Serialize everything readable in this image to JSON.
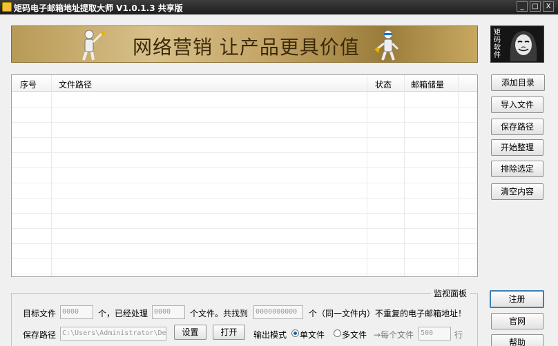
{
  "window": {
    "title": "矩码电子邮箱地址提取大师 V1.0.1.3 共享版",
    "min_label": "_",
    "max_label": "□",
    "close_label": "X"
  },
  "banner": {
    "slogan": "网络营销  让产品更具价值",
    "logo_text": "矩码软件"
  },
  "table": {
    "columns": [
      "序号",
      "文件路径",
      "状态",
      "邮箱储量"
    ],
    "rows": []
  },
  "side_buttons": [
    "添加目录",
    "导入文件",
    "保存路径",
    "开始整理",
    "排除选定",
    "清空内容"
  ],
  "bottom_buttons": [
    "注册",
    "官网",
    "帮助"
  ],
  "monitor": {
    "title": "监视面板",
    "target_label": "目标文件",
    "target_value": "0000",
    "processed_label": "个，已经处理",
    "processed_value": "0000",
    "found_label": "个文件。共找到",
    "found_value": "0000000000",
    "unique_label": "个（同一文件内）不重复的电子邮箱地址！",
    "save_path_label": "保存路径",
    "save_path_value": "C:\\Users\\Administrator\\Des",
    "set_button": "设置",
    "open_button": "打开",
    "mode_label": "输出模式",
    "mode_options": [
      "单文件",
      "多文件"
    ],
    "mode_selected": "单文件",
    "per_file_label": "→每个文件",
    "per_file_value": "500",
    "lines_label": "行"
  }
}
